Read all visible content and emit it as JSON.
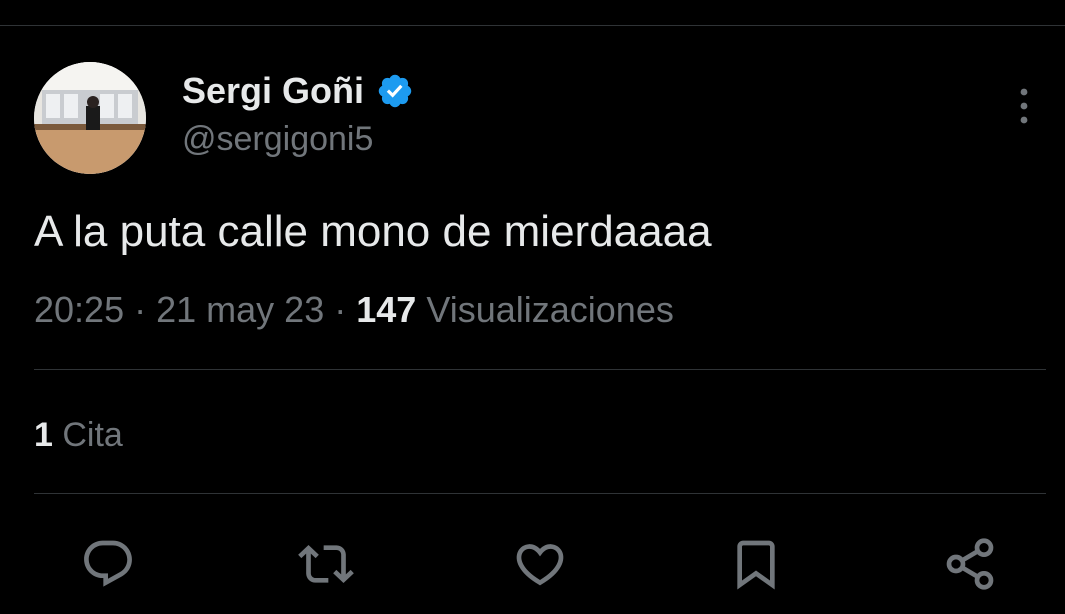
{
  "tweet": {
    "author": {
      "display_name": "Sergi Goñi",
      "handle": "@sergigoni5",
      "verified": true
    },
    "text": "A la puta calle mono de mierdaaaa",
    "time": "20:25",
    "separator": "·",
    "date": "21 may 23",
    "views_count": "147",
    "views_label": "Visualizaciones",
    "quotes_count": "1",
    "quotes_label": "Cita"
  },
  "actions": [
    {
      "icon": "reply-icon"
    },
    {
      "icon": "retweet-icon"
    },
    {
      "icon": "like-icon"
    },
    {
      "icon": "bookmark-icon"
    },
    {
      "icon": "share-icon"
    }
  ],
  "colors": {
    "background": "#000000",
    "primary_text": "#e7e9ea",
    "secondary_text": "#71767b",
    "divider": "#2f3336",
    "verified_badge": "#1d9bf0"
  }
}
